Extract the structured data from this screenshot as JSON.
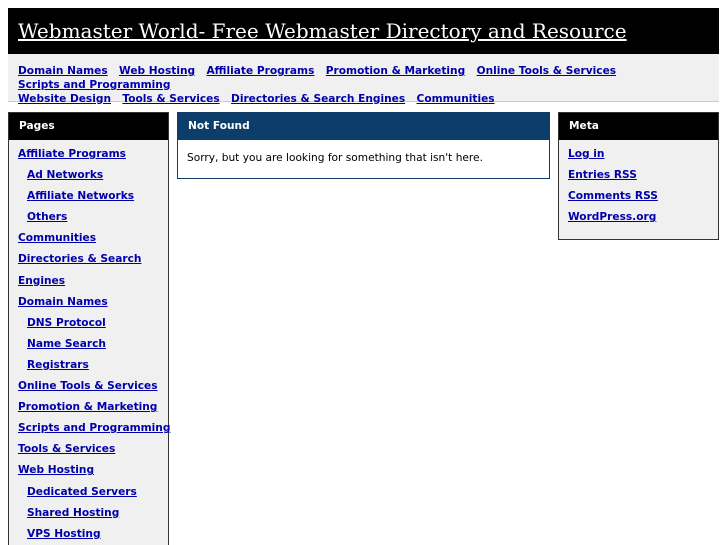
{
  "header": {
    "title": "Webmaster World- Free Webmaster Directory and Resource"
  },
  "topnav": {
    "links": [
      "Domain Names",
      "Web Hosting",
      "Affiliate Programs",
      "Promotion & Marketing",
      "Online Tools & Services",
      "Scripts and Programming",
      "Website Design",
      "Tools & Services",
      "Directories & Search Engines",
      "Communities"
    ]
  },
  "pages": {
    "heading": "Pages",
    "items": [
      {
        "label": "Affiliate Programs",
        "level": 0
      },
      {
        "label": "Ad Networks",
        "level": 1
      },
      {
        "label": "Affiliate Networks",
        "level": 1
      },
      {
        "label": "Others",
        "level": 1
      },
      {
        "label": "Communities",
        "level": 0
      },
      {
        "label": "Directories & Search",
        "level": 0
      },
      {
        "label": "Engines",
        "level": 0
      },
      {
        "label": "Domain Names",
        "level": 0
      },
      {
        "label": "DNS Protocol",
        "level": 1
      },
      {
        "label": "Name Search",
        "level": 1
      },
      {
        "label": "Registrars",
        "level": 1
      },
      {
        "label": "Online Tools & Services",
        "level": 0
      },
      {
        "label": "Promotion & Marketing",
        "level": 0
      },
      {
        "label": "Scripts and Programming",
        "level": 0
      },
      {
        "label": "Tools & Services",
        "level": 0
      },
      {
        "label": "Web Hosting",
        "level": 0
      },
      {
        "label": "Dedicated Servers",
        "level": 1
      },
      {
        "label": "Shared Hosting",
        "level": 1
      },
      {
        "label": "VPS Hosting",
        "level": 1
      }
    ]
  },
  "main": {
    "heading": "Not Found",
    "message": "Sorry, but you are looking for something that isn't here."
  },
  "meta": {
    "heading": "Meta",
    "items": [
      "Log in",
      "Entries RSS",
      "Comments RSS",
      "WordPress.org"
    ]
  },
  "colors": {
    "header_bg": "#000000",
    "main_heading_bg": "#0d3d6b",
    "link": "#0000aa",
    "sidebar_bg": "#f0f0f0"
  }
}
